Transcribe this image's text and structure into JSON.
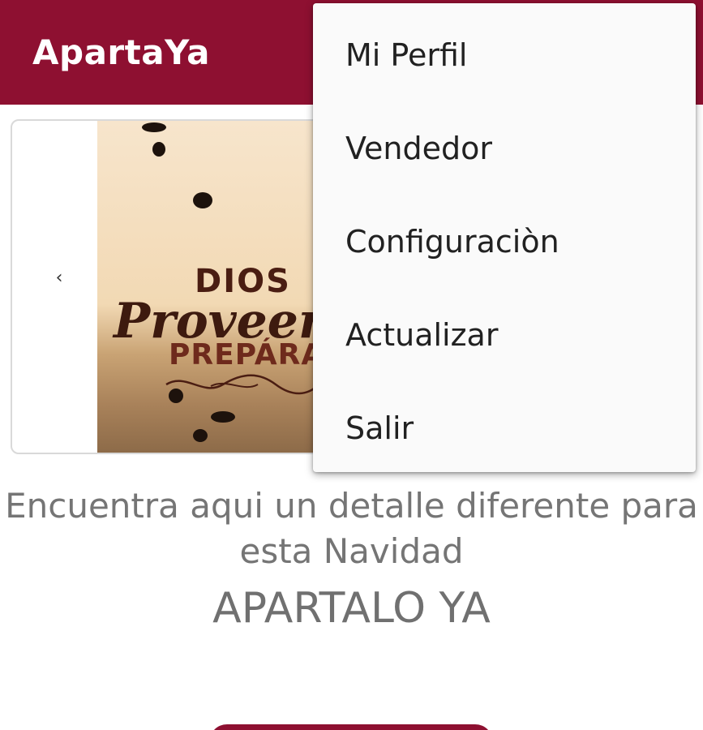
{
  "appbar": {
    "title": "ApartaYa",
    "color": "#8e1031"
  },
  "banner": {
    "prev_icon": "chevron-left-icon",
    "image_lines": [
      "DIOS",
      "Proveer",
      "PREPÁRAT"
    ]
  },
  "content": {
    "tagline": "Encuentra aqui un detalle diferente para esta Navidad",
    "headline": "APARTALO YA"
  },
  "menu": {
    "items": [
      {
        "label": "Mi Perfil"
      },
      {
        "label": "Vendedor"
      },
      {
        "label": "Configuraciòn"
      },
      {
        "label": "Actualizar"
      },
      {
        "label": "Salir"
      }
    ]
  }
}
